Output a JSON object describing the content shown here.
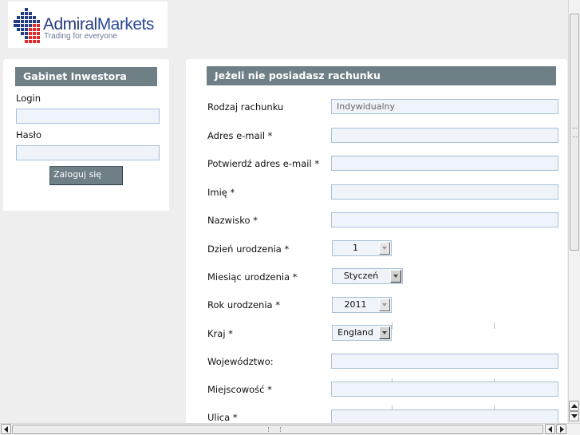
{
  "logo": {
    "brand_part1": "Admiral",
    "brand_part2": "Markets",
    "tagline": "Trading for everyone",
    "colors": {
      "blue": "#253c7d",
      "red": "#e02a2a"
    }
  },
  "login_panel": {
    "title": "Gabinet Inwestora",
    "login_label": "Login",
    "login_value": "",
    "password_label": "Hasło",
    "password_value": "",
    "submit_label": "Zaloguj się"
  },
  "register_panel": {
    "title": "Jeżeli nie posiadasz rachunku",
    "fields": {
      "account_type": {
        "label": "Rodzaj rachunku",
        "value": "Indywidualny"
      },
      "email": {
        "label": "Adres e-mail *",
        "value": ""
      },
      "email_confirm": {
        "label": "Potwierdź adres e-mail *",
        "value": ""
      },
      "first_name": {
        "label": "Imię *",
        "value": ""
      },
      "last_name": {
        "label": "Nazwisko *",
        "value": ""
      },
      "birth_day": {
        "label": "Dzień urodzenia *",
        "value": "1"
      },
      "birth_month": {
        "label": "Miesiąc urodzenia *",
        "value": "Styczeń"
      },
      "birth_year": {
        "label": "Rok urodzenia *",
        "value": "2011"
      },
      "country": {
        "label": "Kraj *",
        "value": "England"
      },
      "province": {
        "label": "Województwo:",
        "value": ""
      },
      "city": {
        "label": "Miejscowość *",
        "value": ""
      },
      "street": {
        "label": "Ulica *",
        "value": ""
      }
    }
  },
  "theme": {
    "panel_header": "#6f7f86",
    "input_bg": "#eef4fa",
    "input_border": "#a8c0d8",
    "page_bg": "#eeeeee"
  }
}
